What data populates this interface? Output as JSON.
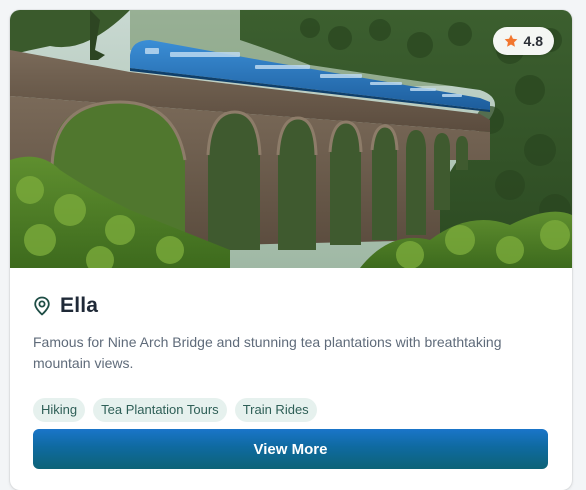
{
  "card": {
    "image_alt": "Nine Arch Bridge with blue train crossing through tea plantations",
    "rating": "4.8",
    "title": "Ella",
    "description": "Famous for Nine Arch Bridge and stunning tea plantations with breathtaking mountain views.",
    "tags": [
      "Hiking",
      "Tea Plantation Tours",
      "Train Rides"
    ],
    "cta_label": "View More"
  },
  "icons": {
    "rating": "star-icon",
    "location": "map-pin-icon"
  },
  "colors": {
    "star": "#f2762e",
    "tag_bg": "#e6f1ee",
    "tag_text": "#2e5f57",
    "button_top": "#1a75c9",
    "button_bottom": "#0d6377",
    "pin": "#1e4d45"
  }
}
